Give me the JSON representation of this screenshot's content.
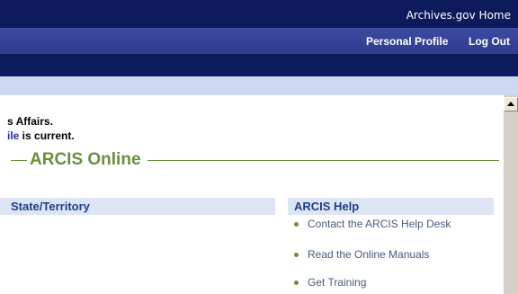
{
  "top_nav": {
    "home_link": "Archives.gov Home"
  },
  "profile_bar": {
    "personal_profile": "Personal Profile",
    "log_out": "Log Out"
  },
  "status": {
    "line1": "s Affairs.",
    "line2_prefix": "ile",
    "line2_rest": " is current."
  },
  "section": {
    "title": "ARCIS Online"
  },
  "panels": {
    "state_header": "State/Territory",
    "help_header": "ARCIS Help",
    "help_items": [
      "Contact the ARCIS Help Desk",
      "Read the Online Manuals",
      "Get Training"
    ]
  },
  "colors": {
    "nav_dark": "#0d1a5c",
    "highlight": "#cc1c25",
    "accent_green": "#6b8f3f",
    "header_blue": "#1f3c88"
  }
}
